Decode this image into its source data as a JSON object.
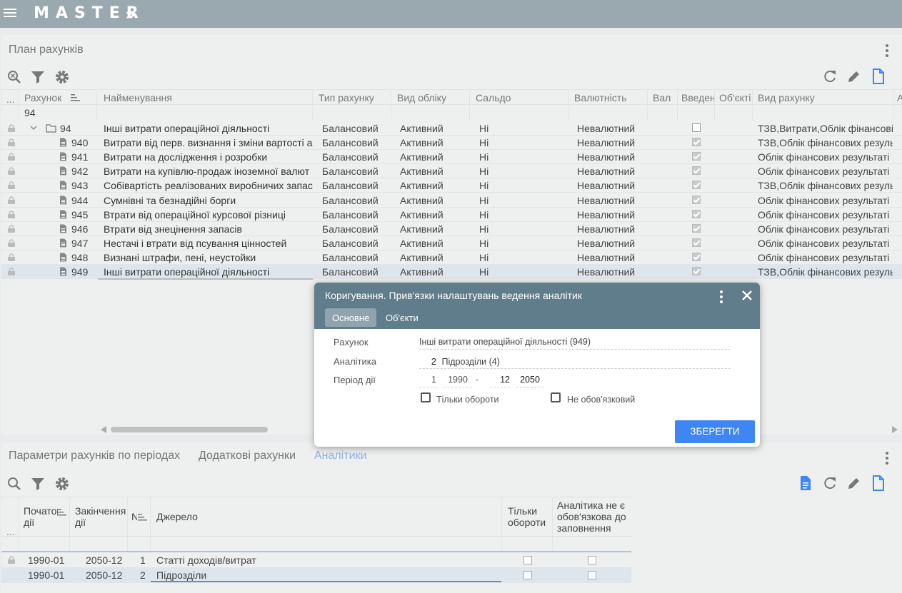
{
  "app": {
    "logo": "MASTER",
    "logo_arrow": "»"
  },
  "plan": {
    "title": "План рахунків",
    "columns": [
      "...",
      "Рахунок",
      "Найменування",
      "Тип рахунку",
      "Вид обліку",
      "Сальдо",
      "Валютність",
      "Вал",
      "Введен",
      "Об'єкті",
      "Вид рахунку",
      "А"
    ],
    "filter_value": "94",
    "rows": [
      {
        "code": "94",
        "name": "Інші витрати операційної діяльності",
        "type": "Балансовий",
        "kind": "Активний",
        "saldo": "Ні",
        "currency": "Невалютний",
        "entered": false,
        "account_type": "ТЗВ,Витрати,Облік фінансові",
        "folder": true
      },
      {
        "code": "940",
        "name": "Витрати від перв. визнання і зміни вартості а",
        "type": "Балансовий",
        "kind": "Активний",
        "saldo": "Ні",
        "currency": "Невалютний",
        "entered": true,
        "account_type": "ТЗВ,Облік фінансових резуль"
      },
      {
        "code": "941",
        "name": "Витрати на дослідження і розробки",
        "type": "Балансовий",
        "kind": "Активний",
        "saldo": "Ні",
        "currency": "Невалютний",
        "entered": true,
        "account_type": "Облік фінансових результаті"
      },
      {
        "code": "942",
        "name": "Витрати на купівлю-продаж іноземної валют",
        "type": "Балансовий",
        "kind": "Активний",
        "saldo": "Ні",
        "currency": "Невалютний",
        "entered": true,
        "account_type": "Облік фінансових результаті"
      },
      {
        "code": "943",
        "name": "Собівартість реалізованих виробничих запас",
        "type": "Балансовий",
        "kind": "Активний",
        "saldo": "Ні",
        "currency": "Невалютний",
        "entered": true,
        "account_type": "ТЗВ,Облік фінансових резуль"
      },
      {
        "code": "944",
        "name": "Сумнівні та безнадійні борги",
        "type": "Балансовий",
        "kind": "Активний",
        "saldo": "Ні",
        "currency": "Невалютний",
        "entered": true,
        "account_type": "Облік фінансових результаті"
      },
      {
        "code": "945",
        "name": "Втрати від операційної курсової різниці",
        "type": "Балансовий",
        "kind": "Активний",
        "saldo": "Ні",
        "currency": "Невалютний",
        "entered": true,
        "account_type": "Облік фінансових результаті"
      },
      {
        "code": "946",
        "name": "Втрати від знецінення запасів",
        "type": "Балансовий",
        "kind": "Активний",
        "saldo": "Ні",
        "currency": "Невалютний",
        "entered": true,
        "account_type": "Облік фінансових результаті"
      },
      {
        "code": "947",
        "name": "Нестачі і втрати від псування цінностей",
        "type": "Балансовий",
        "kind": "Активний",
        "saldo": "Ні",
        "currency": "Невалютний",
        "entered": true,
        "account_type": "Облік фінансових результаті"
      },
      {
        "code": "948",
        "name": "Визнані штрафи, пені, неустойки",
        "type": "Балансовий",
        "kind": "Активний",
        "saldo": "Ні",
        "currency": "Невалютний",
        "entered": true,
        "account_type": "Облік фінансових результаті"
      },
      {
        "code": "949",
        "name": "Інші витрати операційної діяльності",
        "type": "Балансовий",
        "kind": "Активний",
        "saldo": "Ні",
        "currency": "Невалютний",
        "entered": true,
        "account_type": "ТЗВ,Облік фінансових резуль"
      }
    ]
  },
  "bottom": {
    "tabs": [
      "Параметри рахунків по періодах",
      "Додаткові рахунки",
      "Аналітики"
    ],
    "columns": {
      "start": "Початок дії",
      "end": "Закінчення дії",
      "num": "N",
      "source": "Джерело",
      "only_turnover": "Тільки обороти",
      "not_required": "Аналітика не є обов'язкова до заповнення"
    },
    "col_more": "...",
    "rows": [
      {
        "start": "1990-01",
        "end": "2050-12",
        "num": "1",
        "source": "Статті доходів/витрат",
        "only_turnover": false,
        "not_required": false
      },
      {
        "start": "1990-01",
        "end": "2050-12",
        "num": "2",
        "source": "Підрозділи",
        "only_turnover": false,
        "not_required": false
      }
    ]
  },
  "modal": {
    "title": "Коригування. Прив'язки налаштувань ведення аналітик",
    "tabs": [
      "Основне",
      "Об'єкти"
    ],
    "account_label": "Рахунок",
    "account_value": "Інші витрати операційної діяльності (949)",
    "analytics_label": "Аналітика",
    "analytics_num": "2",
    "analytics_value": "Підрозділи (4)",
    "period_label": "Період дії",
    "period_start_month": "1",
    "period_start_year": "1990",
    "period_sep": "-",
    "period_end_month": "12",
    "period_end_year": "2050",
    "only_turnover_label": "Тільки обороти",
    "not_required_label": "Не обов'язковий",
    "save_label": "ЗБЕРЕГТИ"
  }
}
